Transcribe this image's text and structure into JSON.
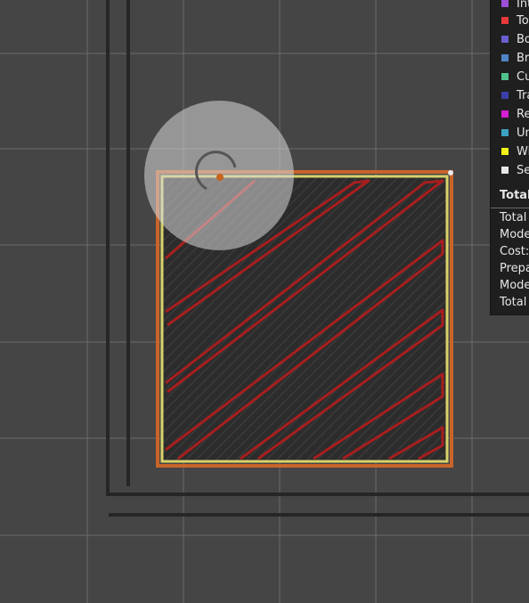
{
  "legend": {
    "items": [
      {
        "label": "Int",
        "color": "#9b4fd6"
      },
      {
        "label": "To",
        "color": "#e8383a"
      },
      {
        "label": "Bo",
        "color": "#6a5fcf"
      },
      {
        "label": "Bri",
        "color": "#4f86c8"
      },
      {
        "label": "Cu",
        "color": "#4fc28a"
      },
      {
        "label": "Tra",
        "color": "#3b3fa8"
      },
      {
        "label": "Re",
        "color": "#d21fd2"
      },
      {
        "label": "Un",
        "color": "#3aa2c2"
      },
      {
        "label": "Wi",
        "color": "#f2f21a"
      },
      {
        "label": "Se",
        "color": "#e8e8e8"
      }
    ],
    "stats_title": "Total",
    "stats": [
      "Total",
      "Mode",
      "Cost:",
      "Prepa",
      "Mode",
      "Total"
    ]
  },
  "colors": {
    "background": "#454545",
    "grid": "#6b6b6b",
    "plate_border": "#2a2a2a",
    "skirt_outer": "#c8642a",
    "perimeter_yellow": "#d8d26a",
    "infill_red": "#a81e1e",
    "top_surface": "#2e2e2e"
  },
  "icons": {
    "gizmo": "rotate-gizmo-icon"
  }
}
